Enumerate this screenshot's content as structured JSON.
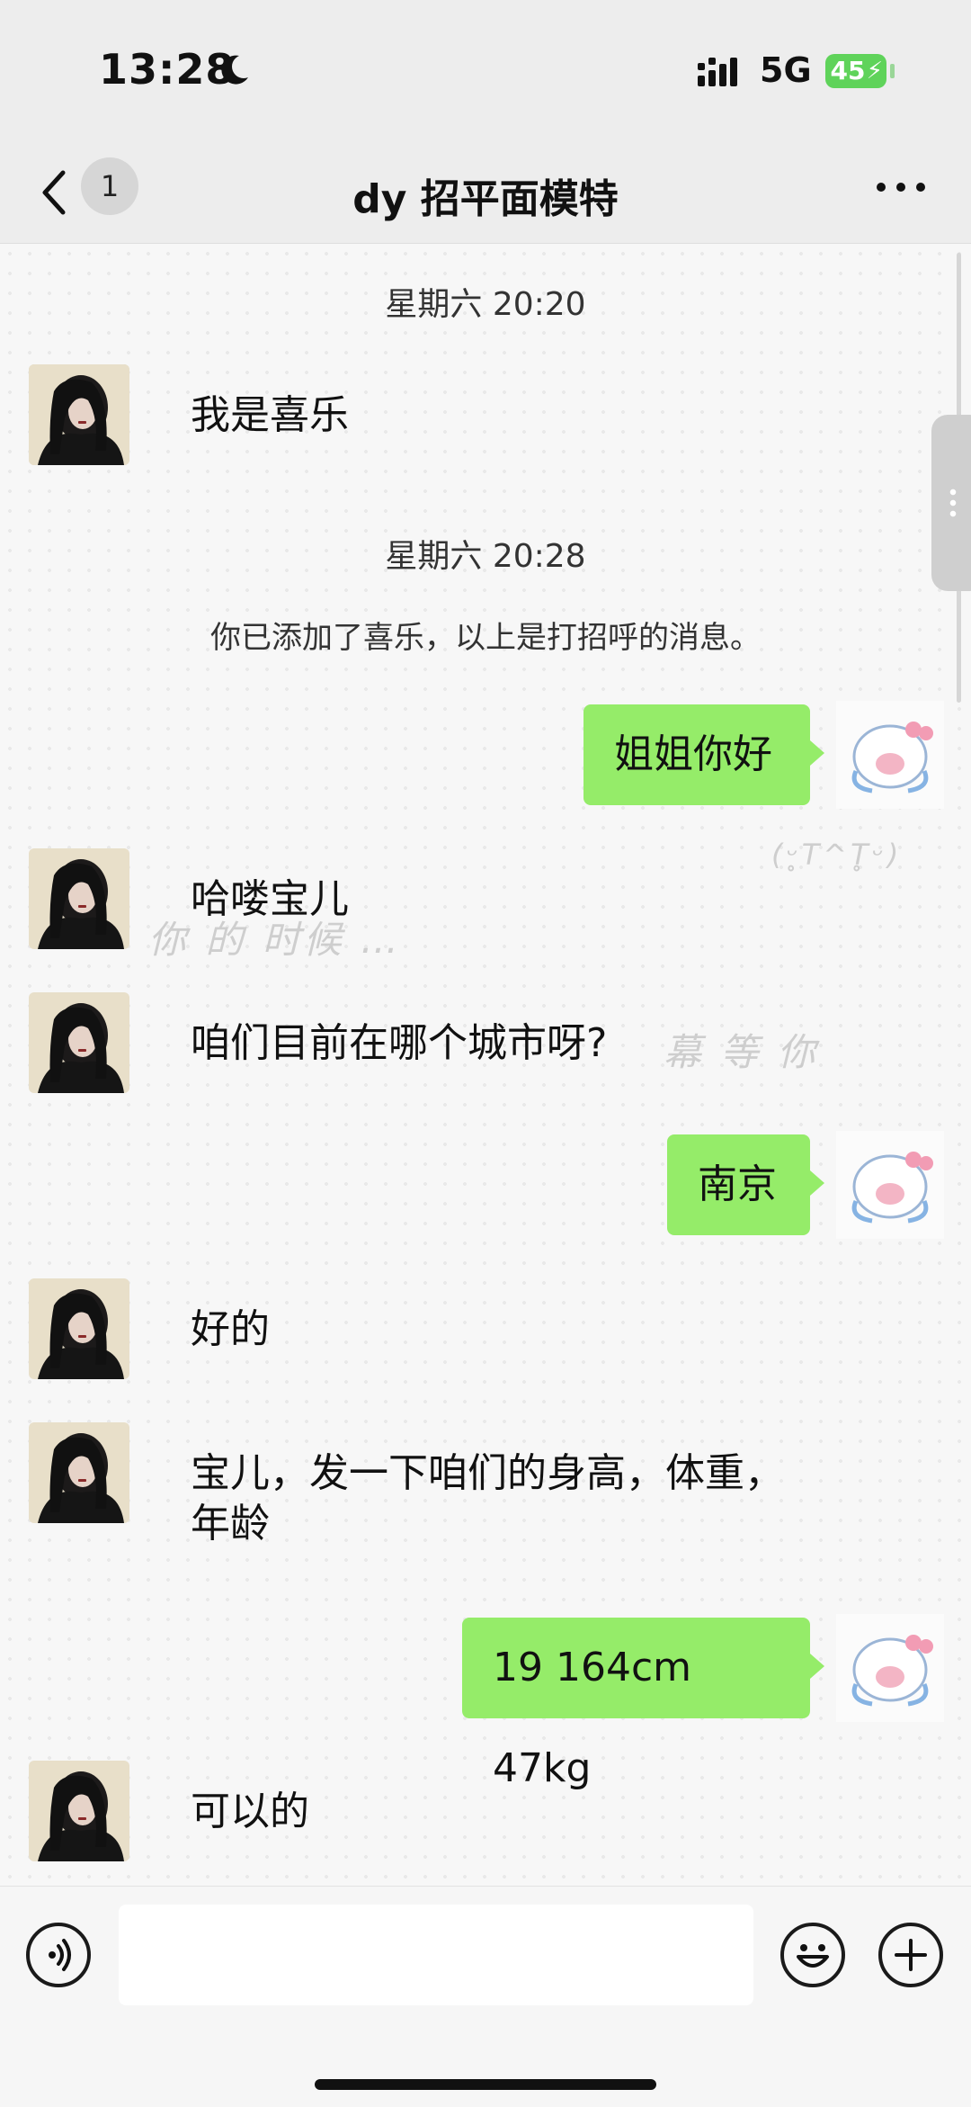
{
  "status": {
    "time": "13:28",
    "network": "5G",
    "battery": "45"
  },
  "nav": {
    "unread": "1",
    "title": "dy 招平面模特"
  },
  "messages": {
    "ts1": "星期六 20:20",
    "m1": "我是喜乐",
    "ts2": "星期六 20:28",
    "system": "你已添加了喜乐，以上是打招呼的消息。",
    "out1": "姐姐你好",
    "m2": "哈喽宝儿",
    "m3": "咱们目前在哪个城市呀?",
    "out2": "南京",
    "m4": "好的",
    "m5_line1": "宝儿，发一下咱们的身高，体重，",
    "m5_line2": "年龄",
    "out3": "19 164cm 47kg",
    "m6": "可以的"
  },
  "decor": {
    "d1": "(ᵕ̥T^T̥ᵕ)",
    "d2": "你 的 时候 …",
    "d3": "幕 等 你"
  },
  "colors": {
    "bubble_out": "#95ec69",
    "battery": "#5fd35a",
    "navbar": "#ededed"
  },
  "icons": [
    "moon-icon",
    "signal-icon",
    "battery-icon",
    "back-icon",
    "more-icon",
    "voice-icon",
    "emoji-icon",
    "plus-icon"
  ]
}
